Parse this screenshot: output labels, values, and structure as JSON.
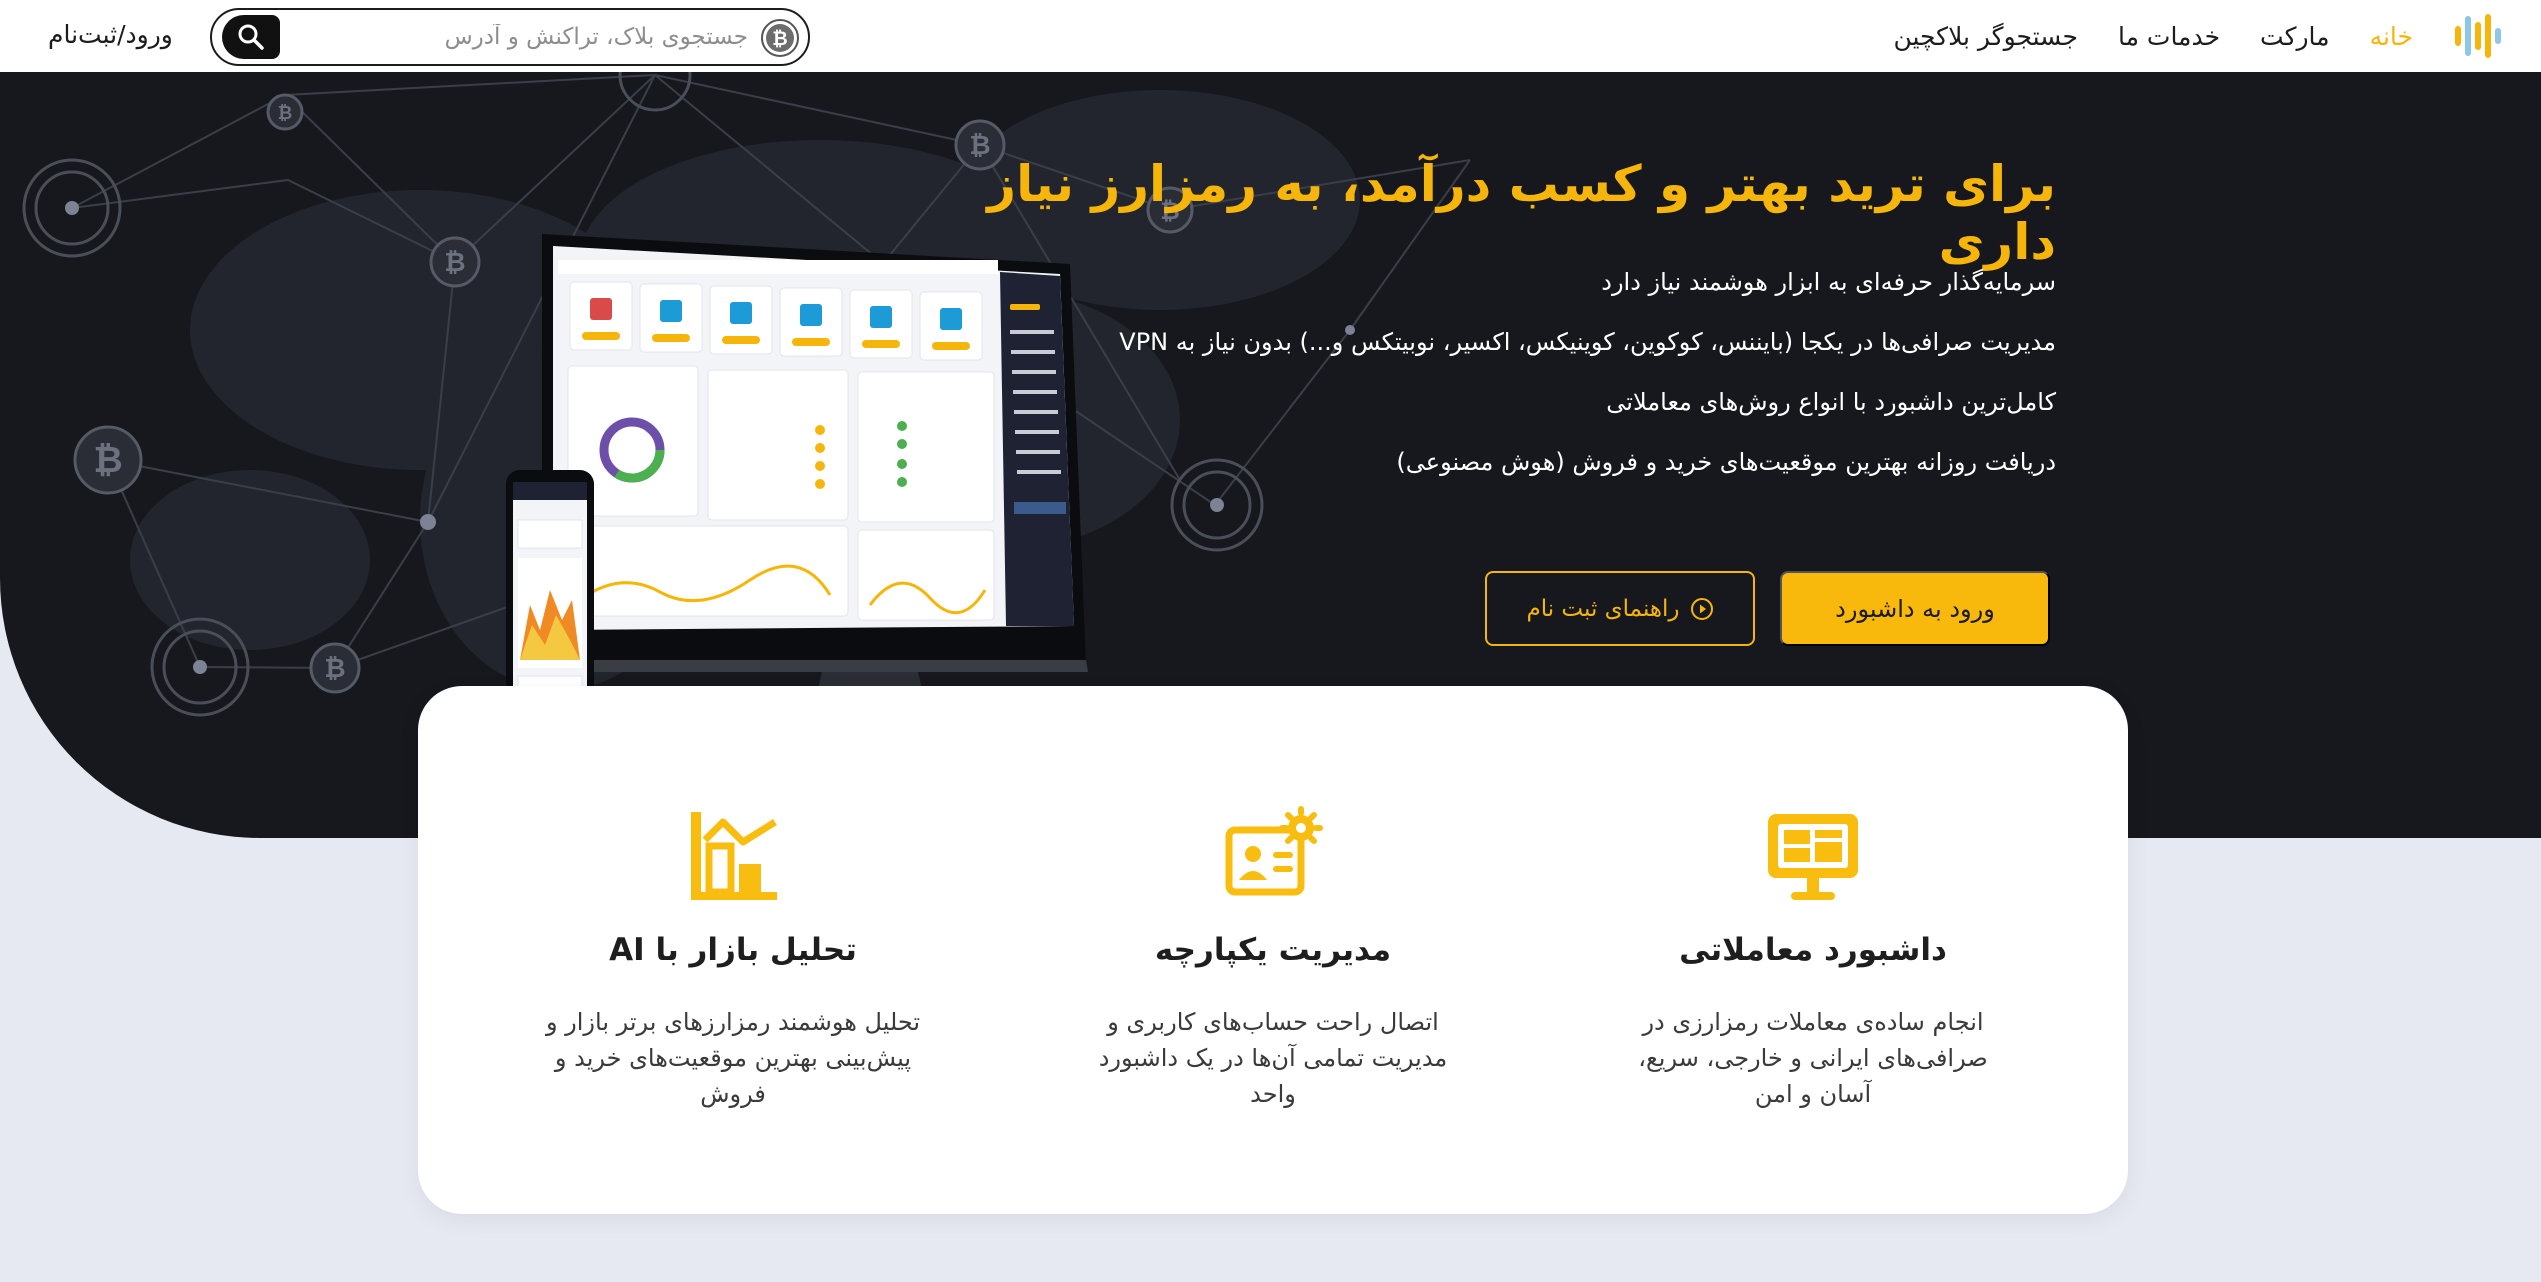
{
  "nav": {
    "links": [
      "خانه",
      "مارکت",
      "خدمات ما",
      "جستجوگر بلاکچین"
    ],
    "active_index": 0,
    "search_placeholder": "جستجوی بلاک، تراکنش و آدرس",
    "login": "ورود/ثبت‌نام",
    "logo_icon": "brand-bars-logo",
    "search_icon": "magnifier-icon",
    "currency_icon": "bitcoin-icon"
  },
  "hero": {
    "title": "برای ترید بهتر و کسب درآمد، به رمزارز نیاز داری",
    "lines": [
      "سرمایه‌گذار حرفه‌ای به ابزار هوشمند نیاز دارد",
      "مدیریت صرافی‌ها در یکجا (بایننس، کوکوین، کوینیکس، اکسیر، نوبیتکس و...) بدون نیاز به VPN",
      "کامل‌ترین داشبورد با انواع روش‌های معاملاتی",
      "دریافت روزانه بهترین موقعیت‌های خرید و فروش (هوش مصنوعی)"
    ],
    "primary_button": "ورود به داشبورد",
    "secondary_button": "راهنمای ثبت نام",
    "secondary_icon": "play-circle-icon"
  },
  "features": [
    {
      "icon": "monitor-dashboard-icon",
      "title": "داشبورد معاملاتی",
      "text": "انجام ساده‌ی معاملات رمزارزی در صرافی‌های ایرانی و خارجی، سریع، آسان و امن"
    },
    {
      "icon": "profile-gear-icon",
      "title": "مدیریت یکپارچه",
      "text": "اتصال راحت حساب‌های کاربری و مدیریت تمامی آن‌ها در یک داشبورد واحد"
    },
    {
      "icon": "building-chart-icon",
      "title": "تحلیل بازار با AI",
      "text": "تحلیل هوشمند رمزارزهای برتر بازار و پیش‌بینی بهترین موقعیت‌های خرید و فروش"
    }
  ],
  "colors": {
    "accent": "#f5b50a",
    "hero_bg": "#16181e",
    "page_bg": "#e6e9f1"
  }
}
